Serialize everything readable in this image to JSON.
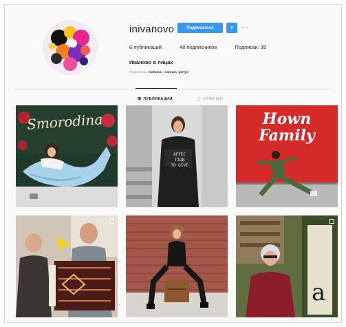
{
  "profile": {
    "username": "inivanovo",
    "follow_label": "Подписаться",
    "dropdown_icon": "chevron-down-icon",
    "options_icon": "more-options-icon",
    "options_glyph": "···",
    "posts_count": "6 публикаций",
    "followers_count": "48 подписчиков",
    "following_count": "Подписки: 35",
    "full_name": "Иваново в лицах",
    "followed_by_prefix": "Подписаны:",
    "followed_by_user1": "ivdrama",
    "followed_by_sep": "и",
    "followed_by_user2": "varvara_gertye"
  },
  "tabs": [
    {
      "label": "ПУБЛИКАЦИИ",
      "icon": "grid-icon",
      "active": true
    },
    {
      "label": "ОТМЕТКИ",
      "icon": "tag-icon",
      "active": false
    }
  ],
  "posts": [
    {
      "id": "post-1",
      "sign_text": "Smorodina",
      "multi": false
    },
    {
      "id": "post-2",
      "shirt_text_1": "AFFEC TION",
      "shirt_text_2": "TO GIVE",
      "multi": false
    },
    {
      "id": "post-3",
      "sign_text_1": "Hown",
      "sign_text_2": "Family",
      "multi": false
    },
    {
      "id": "post-4",
      "multi": true
    },
    {
      "id": "post-5",
      "multi": false
    },
    {
      "id": "post-6",
      "sign_letter": "a",
      "multi": true
    }
  ],
  "colors": {
    "follow_blue": "#3897f0",
    "tile3_red": "#d42a2a"
  }
}
